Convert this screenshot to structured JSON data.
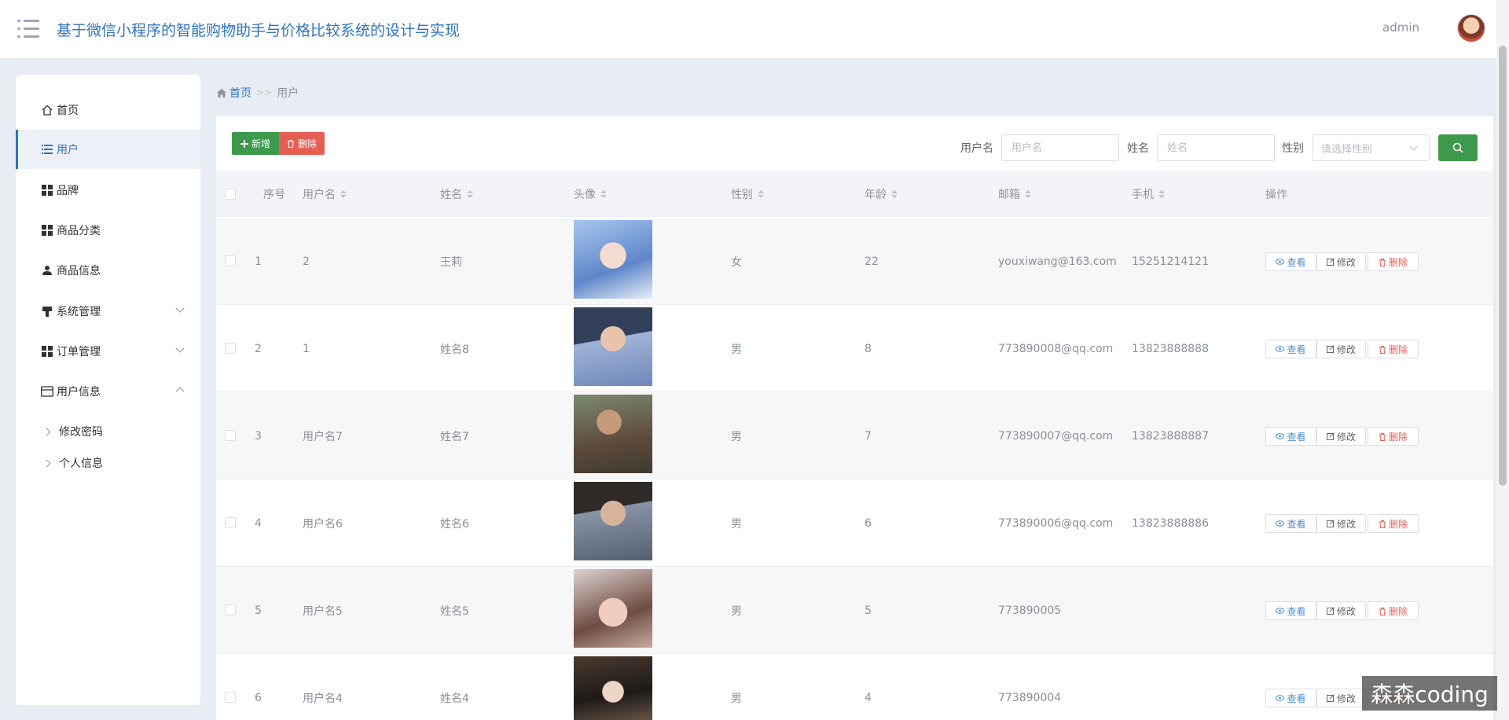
{
  "header": {
    "title": "基于微信小程序的智能购物助手与价格比较系统的设计与实现",
    "username": "admin"
  },
  "sidebar": {
    "items": [
      {
        "label": "首页",
        "icon": "home-icon"
      },
      {
        "label": "用户",
        "icon": "list-icon",
        "active": true
      },
      {
        "label": "品牌",
        "icon": "grid-icon"
      },
      {
        "label": "商品分类",
        "icon": "grid-icon"
      },
      {
        "label": "商品信息",
        "icon": "person-icon"
      },
      {
        "label": "系统管理",
        "icon": "brush-icon",
        "expandable": true
      },
      {
        "label": "订单管理",
        "icon": "grid-icon",
        "expandable": true
      },
      {
        "label": "用户信息",
        "icon": "card-icon",
        "expanded": true
      }
    ],
    "subitems": [
      {
        "label": "修改密码"
      },
      {
        "label": "个人信息"
      }
    ]
  },
  "breadcrumb": {
    "home": "首页",
    "separator": ">>",
    "current": "用户"
  },
  "toolbar": {
    "add_label": "新增",
    "delete_label": "删除",
    "filters": {
      "username_label": "用户名",
      "username_placeholder": "用户名",
      "name_label": "姓名",
      "name_placeholder": "姓名",
      "gender_label": "性别",
      "gender_placeholder": "请选择性别"
    }
  },
  "table": {
    "columns": [
      "序号",
      "用户名",
      "姓名",
      "头像",
      "性别",
      "年龄",
      "邮箱",
      "手机",
      "操作"
    ],
    "actions": {
      "view": "查看",
      "edit": "修改",
      "delete": "删除"
    },
    "rows": [
      {
        "index": "1",
        "username": "2",
        "name": "王莉",
        "avatar": "anime-girl-avatar",
        "gender": "女",
        "age": "22",
        "email": "youxiwang@163.com",
        "phone": "15251214121"
      },
      {
        "index": "2",
        "username": "1",
        "name": "姓名8",
        "avatar": "woman-photo-avatar",
        "gender": "男",
        "age": "8",
        "email": "773890008@qq.com",
        "phone": "13823888888"
      },
      {
        "index": "3",
        "username": "用户名7",
        "name": "姓名7",
        "avatar": "man-photo-avatar",
        "gender": "男",
        "age": "7",
        "email": "773890007@qq.com",
        "phone": "13823888887"
      },
      {
        "index": "4",
        "username": "用户名6",
        "name": "姓名6",
        "avatar": "man-selfie-avatar",
        "gender": "男",
        "age": "6",
        "email": "773890006@qq.com",
        "phone": "13823888886"
      },
      {
        "index": "5",
        "username": "用户名5",
        "name": "姓名5",
        "avatar": "woman-glasses-avatar",
        "gender": "男",
        "age": "5",
        "email": "773890005",
        "phone": ""
      },
      {
        "index": "6",
        "username": "用户名4",
        "name": "姓名4",
        "avatar": "woman-room-avatar",
        "gender": "男",
        "age": "4",
        "email": "773890004",
        "phone": ""
      }
    ]
  },
  "watermark": "森森coding",
  "colors": {
    "accent": "#2f74c0",
    "add": "#3d9a4d",
    "danger": "#e45f52"
  }
}
